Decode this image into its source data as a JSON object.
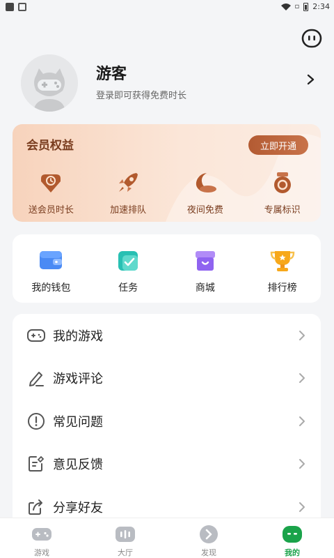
{
  "status_bar": {
    "time": "2:34"
  },
  "profile": {
    "name": "游客",
    "subtitle": "登录即可获得免费时长"
  },
  "vip": {
    "title": "会员权益",
    "button": "立即开通",
    "items": [
      {
        "label": "送会员时长",
        "icon": "clock-tag-icon"
      },
      {
        "label": "加速排队",
        "icon": "rocket-icon"
      },
      {
        "label": "夜间免费",
        "icon": "moon-icon"
      },
      {
        "label": "专属标识",
        "icon": "badge-icon"
      }
    ]
  },
  "tools": [
    {
      "label": "我的钱包",
      "icon": "wallet-icon"
    },
    {
      "label": "任务",
      "icon": "task-icon"
    },
    {
      "label": "商城",
      "icon": "shop-icon"
    },
    {
      "label": "排行榜",
      "icon": "trophy-icon"
    }
  ],
  "menu": [
    {
      "label": "我的游戏",
      "icon": "gamepad-icon"
    },
    {
      "label": "游戏评论",
      "icon": "pen-icon"
    },
    {
      "label": "常见问题",
      "icon": "exclamation-icon"
    },
    {
      "label": "意见反馈",
      "icon": "feedback-icon"
    },
    {
      "label": "分享好友",
      "icon": "share-icon"
    }
  ],
  "bottom_nav": [
    {
      "label": "游戏",
      "icon": "gamepad-icon",
      "active": false
    },
    {
      "label": "大厅",
      "icon": "lobby-icon",
      "active": false
    },
    {
      "label": "发现",
      "icon": "discover-icon",
      "active": false
    },
    {
      "label": "我的",
      "icon": "profile-face-icon",
      "active": true
    }
  ],
  "colors": {
    "accent": "#1aa34a",
    "vip_text": "#7a3d1f",
    "vip_button": "#b35b33"
  }
}
